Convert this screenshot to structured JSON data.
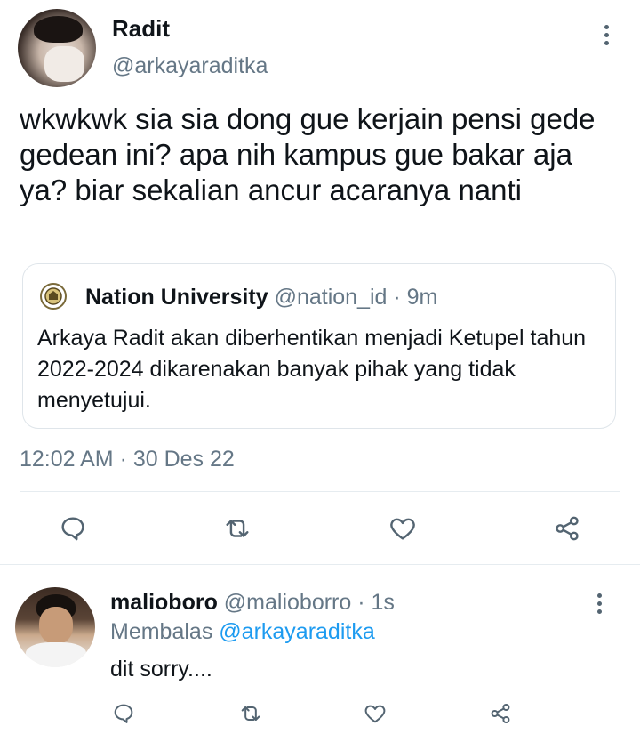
{
  "main_tweet": {
    "author_name": "Radit",
    "author_handle": "@arkayaraditka",
    "text": "wkwkwk sia sia dong gue kerjain pensi gede gedean ini? apa nih kampus gue bakar aja ya? biar sekalian ancur acaranya nanti",
    "timestamp": "12:02 AM · 30 Des 22"
  },
  "quoted_tweet": {
    "author_name": "Nation University",
    "author_handle": "@nation_id",
    "age": "· 9m",
    "text": "Arkaya Radit akan diberhentikan menjadi Ketupel tahun 2022-2024 dikarenakan banyak pihak yang tidak menyetujui."
  },
  "reply": {
    "author_name": "malioboro",
    "author_handle": "@malioborro",
    "age": "· 1s",
    "replying_label": "Membalas",
    "replying_to": "@arkayaraditka",
    "text": "dit sorry...."
  },
  "icons": [
    "more-vert-icon",
    "reply-icon",
    "retweet-icon",
    "like-icon",
    "share-icon",
    "university-seal-icon"
  ],
  "colors": {
    "accent": "#1d9bf0",
    "text": "#0f1419",
    "muted": "#657786",
    "icon": "#536471",
    "border": "#e1e8ed"
  }
}
